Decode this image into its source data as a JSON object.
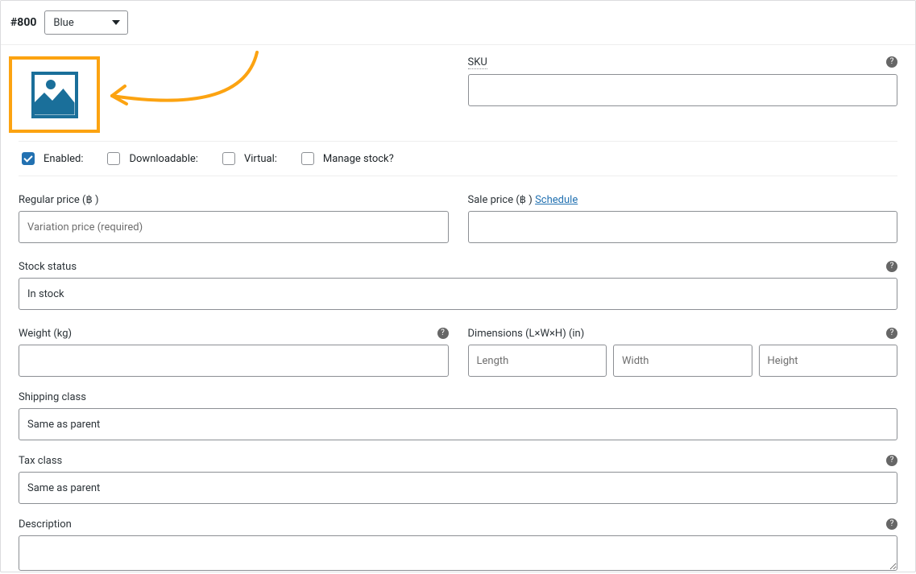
{
  "variation": {
    "id_prefix": "#",
    "id": "800",
    "attribute_value": "Blue"
  },
  "checkboxes": {
    "enabled": {
      "label": "Enabled:",
      "checked": true
    },
    "downloadable": {
      "label": "Downloadable:",
      "checked": false
    },
    "virtual": {
      "label": "Virtual:",
      "checked": false
    },
    "manage_stock": {
      "label": "Manage stock?",
      "checked": false
    }
  },
  "fields": {
    "sku": {
      "label": "SKU",
      "value": ""
    },
    "regular_price": {
      "label": "Regular price (฿ )",
      "placeholder": "Variation price (required)",
      "value": ""
    },
    "sale_price": {
      "label": "Sale price (฿ )",
      "value": "",
      "schedule_link": "Schedule"
    },
    "stock_status": {
      "label": "Stock status",
      "value": "In stock"
    },
    "weight": {
      "label": "Weight (kg)",
      "value": ""
    },
    "dimensions": {
      "label": "Dimensions (L×W×H) (in)",
      "length": {
        "placeholder": "Length",
        "value": ""
      },
      "width": {
        "placeholder": "Width",
        "value": ""
      },
      "height": {
        "placeholder": "Height",
        "value": ""
      }
    },
    "shipping_class": {
      "label": "Shipping class",
      "value": "Same as parent"
    },
    "tax_class": {
      "label": "Tax class",
      "value": "Same as parent"
    },
    "description": {
      "label": "Description",
      "value": ""
    }
  },
  "icons": {
    "help": "?"
  }
}
